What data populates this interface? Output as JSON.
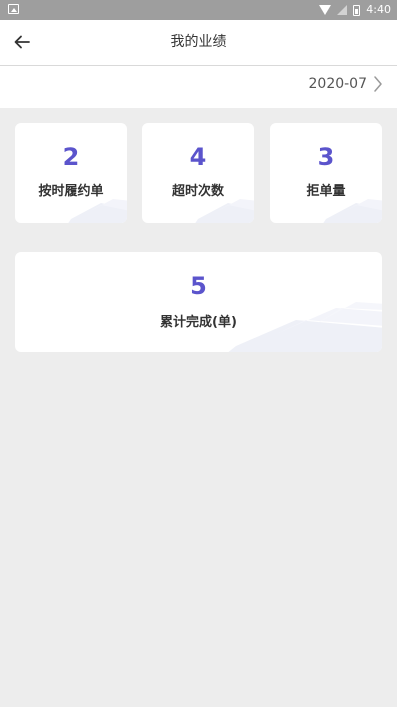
{
  "status_bar": {
    "time": "4:40"
  },
  "header": {
    "title": "我的业绩"
  },
  "month": {
    "value": "2020-07"
  },
  "stats": [
    {
      "value": "2",
      "label": "按时履约单"
    },
    {
      "value": "4",
      "label": "超时次数"
    },
    {
      "value": "3",
      "label": "拒单量"
    }
  ],
  "summary": {
    "value": "5",
    "label": "累计完成(单)"
  },
  "colors": {
    "accent": "#5b54cc",
    "background": "#ededed",
    "card": "#ffffff"
  },
  "icons": {
    "back": "arrow-left-icon",
    "month_next": "chevron-right-icon"
  }
}
